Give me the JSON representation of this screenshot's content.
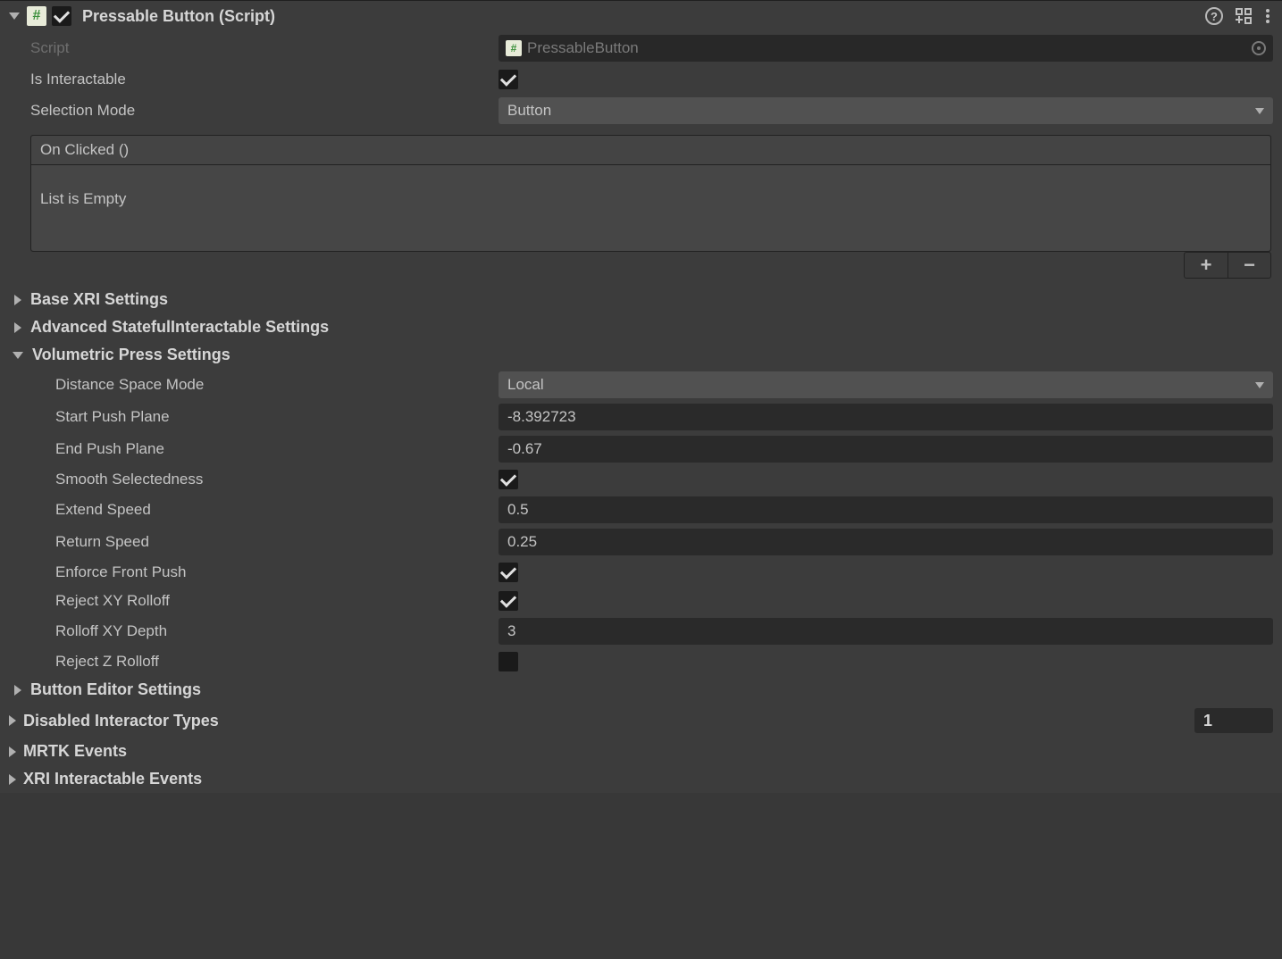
{
  "component": {
    "title": "Pressable Button (Script)",
    "enabled": true
  },
  "script": {
    "label": "Script",
    "value": "PressableButton"
  },
  "isInteractable": {
    "label": "Is Interactable",
    "checked": true
  },
  "selectionMode": {
    "label": "Selection Mode",
    "value": "Button"
  },
  "onClicked": {
    "header": "On Clicked ()",
    "empty": "List is Empty"
  },
  "sections": {
    "baseXRI": "Base XRI Settings",
    "advanced": "Advanced StatefulInteractable Settings",
    "volumetric": "Volumetric Press Settings",
    "buttonEditor": "Button Editor Settings"
  },
  "volumetric": {
    "distanceSpaceMode": {
      "label": "Distance Space Mode",
      "value": "Local"
    },
    "startPushPlane": {
      "label": "Start Push Plane",
      "value": "-8.392723"
    },
    "endPushPlane": {
      "label": "End Push Plane",
      "value": "-0.67"
    },
    "smoothSelectedness": {
      "label": "Smooth Selectedness",
      "checked": true
    },
    "extendSpeed": {
      "label": "Extend Speed",
      "value": "0.5"
    },
    "returnSpeed": {
      "label": "Return Speed",
      "value": "0.25"
    },
    "enforceFrontPush": {
      "label": "Enforce Front Push",
      "checked": true
    },
    "rejectXYRolloff": {
      "label": "Reject XY Rolloff",
      "checked": true
    },
    "rolloffXYDepth": {
      "label": "Rolloff XY Depth",
      "value": "3"
    },
    "rejectZRolloff": {
      "label": "Reject Z Rolloff",
      "checked": false
    }
  },
  "disabledInteractor": {
    "label": "Disabled Interactor Types",
    "count": "1"
  },
  "mrtkEvents": "MRTK Events",
  "xriEvents": "XRI Interactable Events"
}
